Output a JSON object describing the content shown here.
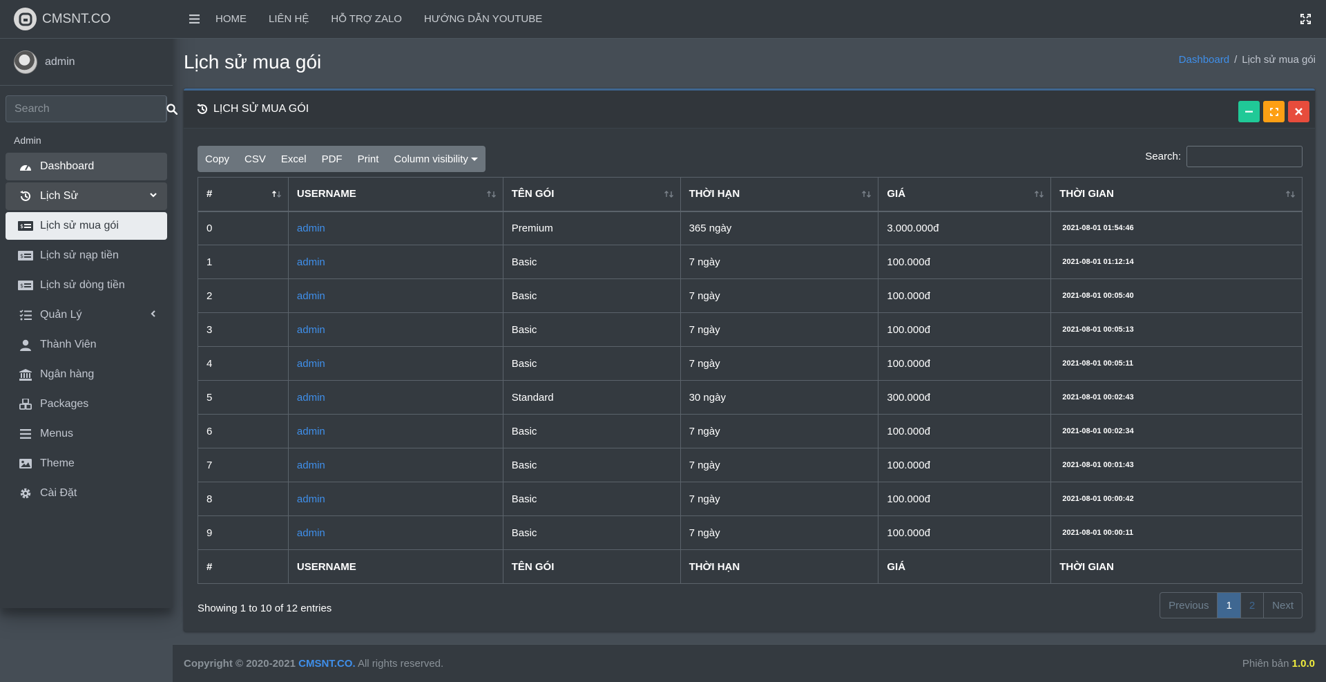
{
  "brand": {
    "name": "CMSNT.CO"
  },
  "user": {
    "name": "admin"
  },
  "sidebar": {
    "search_placeholder": "Search",
    "header": "Admin",
    "items": [
      {
        "label": "Dashboard",
        "icon": "tachometer-icon"
      },
      {
        "label": "Lịch Sử",
        "icon": "history-icon"
      },
      {
        "label": "Lịch sử mua gói",
        "icon": "money-bill-icon"
      },
      {
        "label": "Lịch sử nạp tiền",
        "icon": "money-bill-icon"
      },
      {
        "label": "Lịch sử dòng tiền",
        "icon": "money-bill-icon"
      },
      {
        "label": "Quản Lý",
        "icon": "list-check-icon"
      },
      {
        "label": "Thành Viên",
        "icon": "user-icon"
      },
      {
        "label": "Ngân hàng",
        "icon": "bank-icon"
      },
      {
        "label": "Packages",
        "icon": "boxes-icon"
      },
      {
        "label": "Menus",
        "icon": "bars-icon"
      },
      {
        "label": "Theme",
        "icon": "image-icon"
      },
      {
        "label": "Cài Đặt",
        "icon": "gear-icon"
      }
    ]
  },
  "topnav": {
    "links": [
      "HOME",
      "LIÊN HỆ",
      "HỖ TRỢ ZALO",
      "HƯỚNG DẪN YOUTUBE"
    ]
  },
  "page": {
    "title": "Lịch sử mua gói"
  },
  "breadcrumb": {
    "home": "Dashboard",
    "separator": "/",
    "current": "Lịch sử mua gói"
  },
  "card": {
    "title": "LỊCH SỬ MUA GÓI"
  },
  "toolbar": {
    "buttons": [
      "Copy",
      "CSV",
      "Excel",
      "PDF",
      "Print",
      "Column visibility"
    ]
  },
  "table_search": {
    "label": "Search:"
  },
  "table": {
    "headers": [
      "#",
      "USERNAME",
      "TÊN GÓI",
      "THỜI HẠN",
      "GIÁ",
      "THỜI GIAN"
    ],
    "rows": [
      [
        "0",
        "admin",
        "Premium",
        "365 ngày",
        "3.000.000đ",
        "2021-08-01 01:54:46"
      ],
      [
        "1",
        "admin",
        "Basic",
        "7 ngày",
        "100.000đ",
        "2021-08-01 01:12:14"
      ],
      [
        "2",
        "admin",
        "Basic",
        "7 ngày",
        "100.000đ",
        "2021-08-01 00:05:40"
      ],
      [
        "3",
        "admin",
        "Basic",
        "7 ngày",
        "100.000đ",
        "2021-08-01 00:05:13"
      ],
      [
        "4",
        "admin",
        "Basic",
        "7 ngày",
        "100.000đ",
        "2021-08-01 00:05:11"
      ],
      [
        "5",
        "admin",
        "Standard",
        "30 ngày",
        "300.000đ",
        "2021-08-01 00:02:43"
      ],
      [
        "6",
        "admin",
        "Basic",
        "7 ngày",
        "100.000đ",
        "2021-08-01 00:02:34"
      ],
      [
        "7",
        "admin",
        "Basic",
        "7 ngày",
        "100.000đ",
        "2021-08-01 00:01:43"
      ],
      [
        "8",
        "admin",
        "Basic",
        "7 ngày",
        "100.000đ",
        "2021-08-01 00:00:42"
      ],
      [
        "9",
        "admin",
        "Basic",
        "7 ngày",
        "100.000đ",
        "2021-08-01 00:00:11"
      ]
    ]
  },
  "table_info": "Showing 1 to 10 of 12 entries",
  "pagination": {
    "previous": "Previous",
    "pages": [
      "1",
      "2"
    ],
    "next": "Next"
  },
  "footer": {
    "copyright": "Copyright © 2020-2021",
    "brand": "CMSNT.CO.",
    "rights": " All rights reserved.",
    "version_label": "Phiên bản",
    "version": "1.0.0"
  },
  "colors": {
    "accent": "#3f8fea",
    "card_border": "#3f6791",
    "version": "#f1ed3d"
  }
}
